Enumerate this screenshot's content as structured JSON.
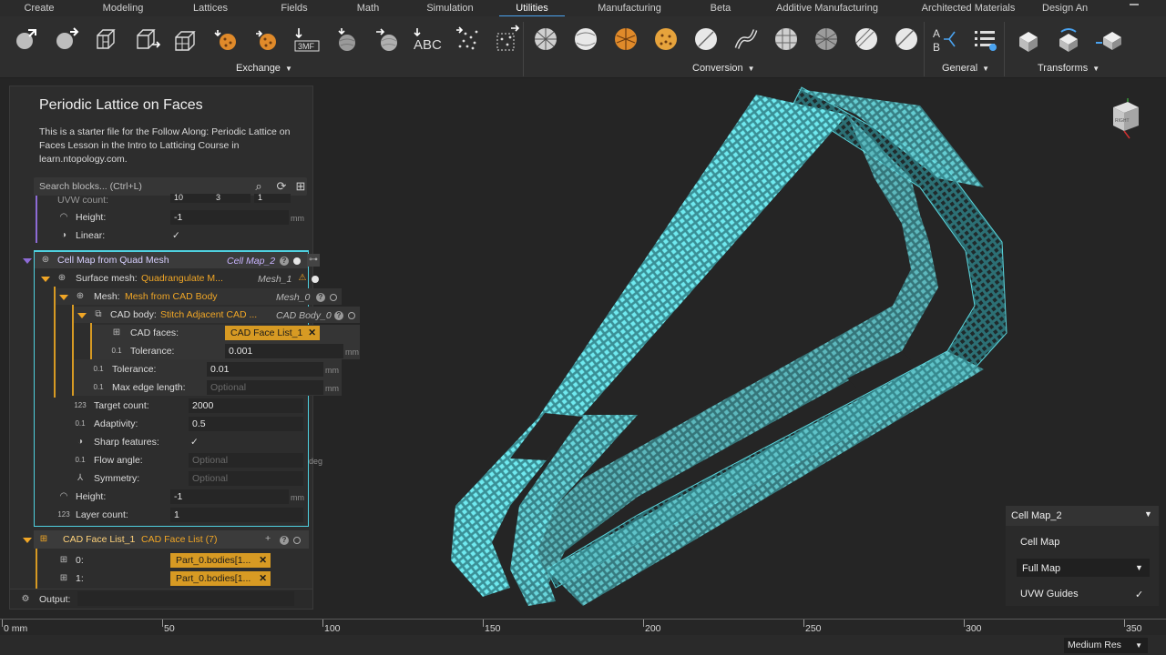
{
  "tabs": [
    "Create",
    "Modeling",
    "Lattices",
    "Fields",
    "Math",
    "Simulation",
    "Utilities",
    "Manufacturing",
    "Beta",
    "Additive Manufacturing",
    "Architected Materials",
    "Design An"
  ],
  "active_tab": "Utilities",
  "ribbon": {
    "exchange_label": "Exchange",
    "conversion_label": "Conversion",
    "general_label": "General",
    "transforms_label": "Transforms",
    "icon_3mf": "3MF",
    "icon_abc": "ABC",
    "icon_ab_a": "A",
    "icon_ab_b": "B"
  },
  "panel": {
    "title": "Periodic Lattice on Faces",
    "description": "This is a starter file for the Follow Along: Periodic Lattice on Faces Lesson in the Intro to Latticing Course in learn.ntopology.com.",
    "search_placeholder": "Search blocks... (Ctrl+L)",
    "rows": {
      "uvw_label": "UVW count:",
      "uvw_values": [
        "10",
        "3",
        "1"
      ],
      "height_label": "Height:",
      "height_value": "-1",
      "linear_label": "Linear:",
      "cellmap_title": "Cell Map from Quad Mesh",
      "cellmap_name": "Cell Map_2",
      "surface_label": "Surface mesh:",
      "surface_value": "Quadrangulate M...",
      "surface_name": "Mesh_1",
      "mesh_label": "Mesh:",
      "mesh_value": "Mesh from CAD Body",
      "mesh_name": "Mesh_0",
      "cadbody_label": "CAD body:",
      "cadbody_value": "Stitch Adjacent CAD ...",
      "cadbody_name": "CAD Body_0",
      "cadfaces_label": "CAD faces:",
      "cadfaces_value": "CAD Face List_1",
      "tol1_label": "Tolerance:",
      "tol1_value": "0.001",
      "tol2_label": "Tolerance:",
      "tol2_value": "0.01",
      "maxedge_label": "Max edge length:",
      "optional": "Optional",
      "target_label": "Target count:",
      "target_value": "2000",
      "adapt_label": "Adaptivity:",
      "adapt_value": "0.5",
      "sharp_label": "Sharp features:",
      "flow_label": "Flow angle:",
      "symmetry_label": "Symmetry:",
      "height2_label": "Height:",
      "height2_value": "-1",
      "layer_label": "Layer count:",
      "layer_value": "1",
      "facelist_name": "CAD Face List_1",
      "facelist_type": "CAD Face List (7)",
      "item0_label": "0:",
      "item0_value": "Part_0.bodies[1...",
      "item1_label": "1:",
      "item1_value": "Part_0.bodies[1...",
      "output_label": "Output:",
      "unit_mm": "mm",
      "unit_deg": "deg",
      "check": "✓"
    }
  },
  "properties": {
    "header": "Cell Map_2",
    "type": "Cell Map",
    "select_value": "Full Map",
    "uvw_guides": "UVW Guides",
    "check": "✓"
  },
  "ruler": {
    "labels": [
      "0 mm",
      "50",
      "100",
      "150",
      "200",
      "250",
      "300",
      "350"
    ]
  },
  "status": {
    "resolution": "Medium Res"
  },
  "view_cube_label": "RIGHT",
  "colors": {
    "accent": "#4aa3f0",
    "orange": "#f0a626",
    "mesh": "#5ee3ea",
    "tag": "#d79a23"
  }
}
